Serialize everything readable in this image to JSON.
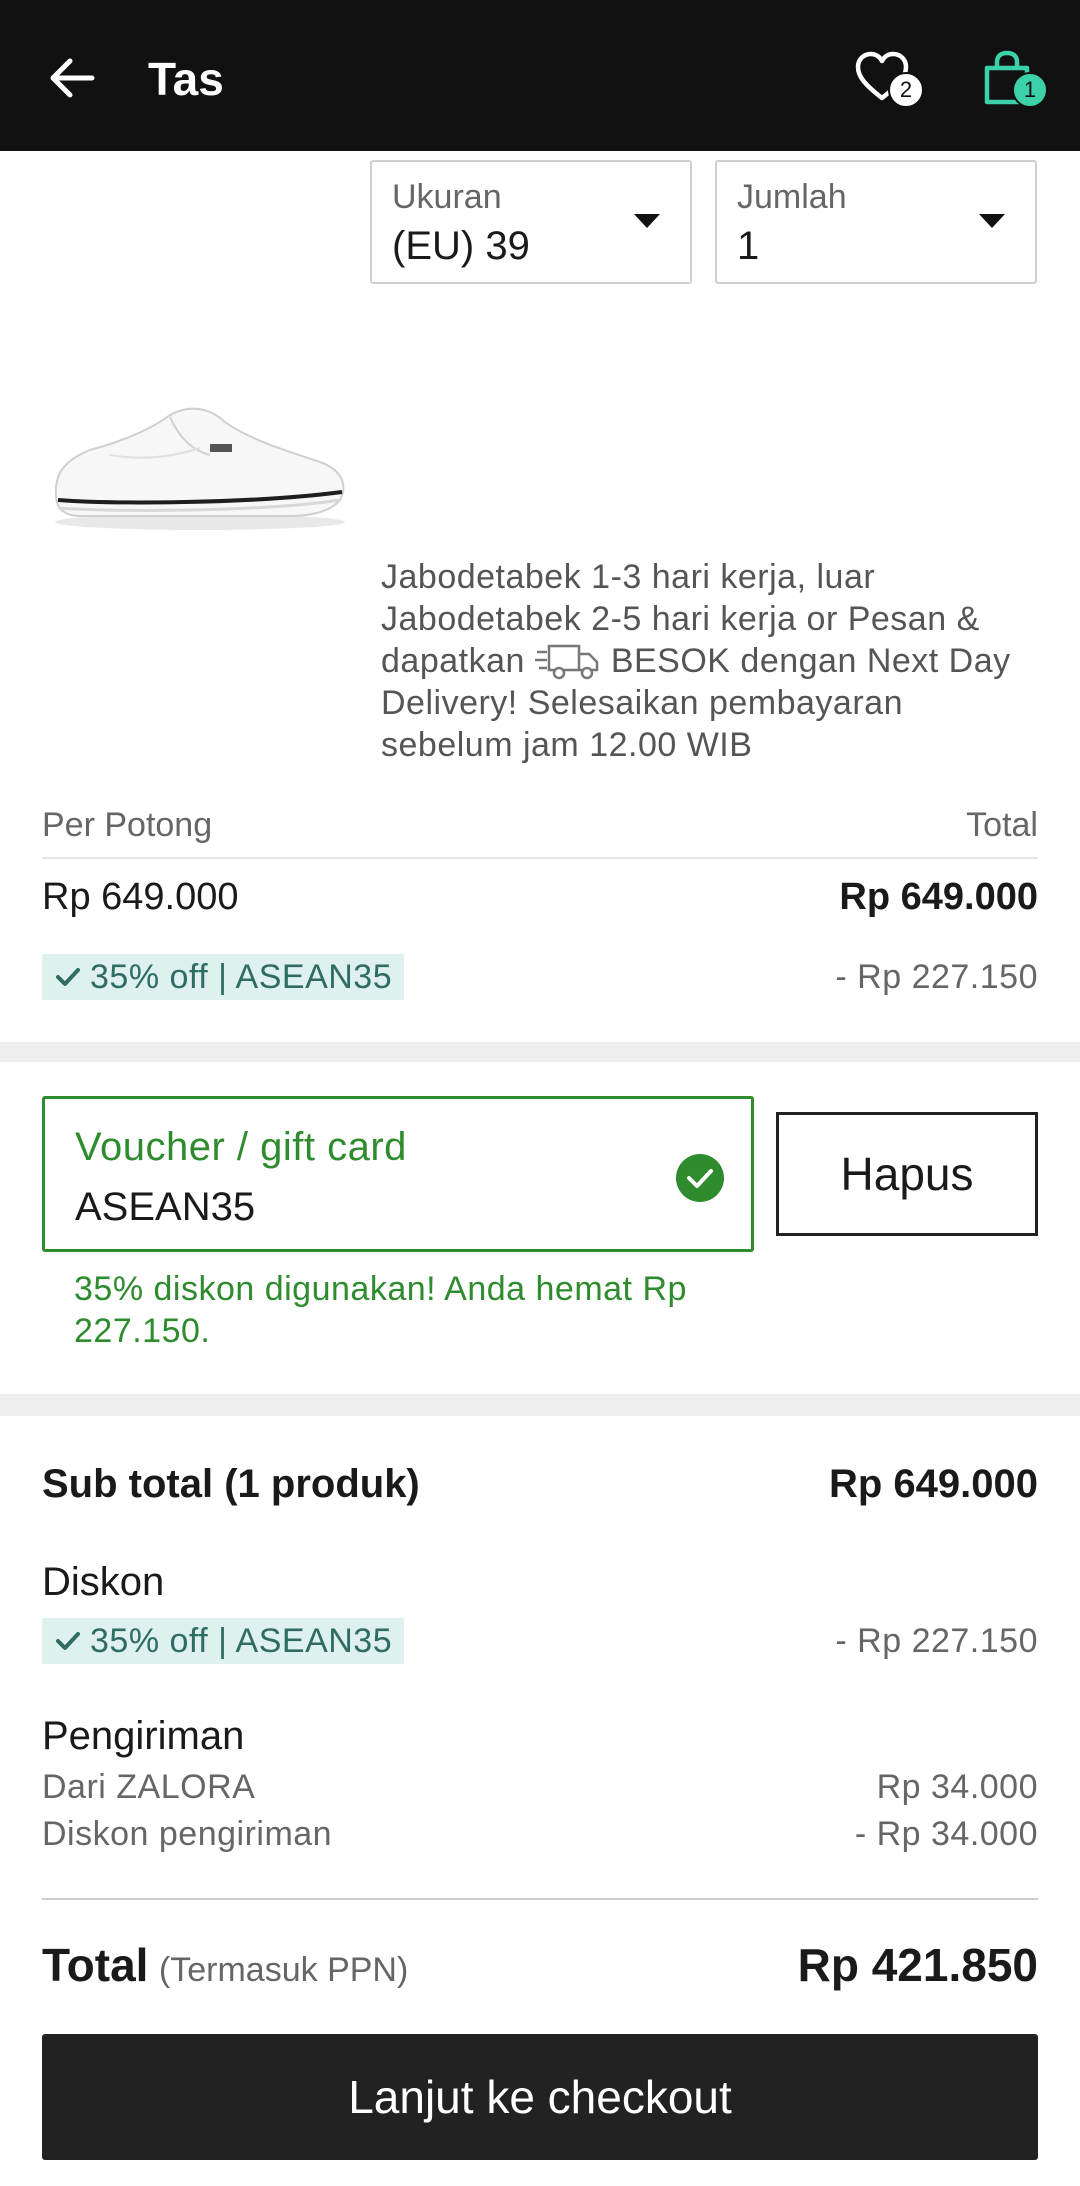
{
  "header": {
    "title": "Tas",
    "wishlist_count": "2",
    "cart_count": "1",
    "colors": {
      "bar": "#111111",
      "cart_accent": "#3cd1a8"
    }
  },
  "item": {
    "size": {
      "label": "Ukuran",
      "value": "(EU) 39"
    },
    "quantity": {
      "label": "Jumlah",
      "value": "1"
    },
    "image_alt": "white sneaker",
    "delivery_part1": "Jabodetabek 1-3 hari kerja, luar Jabodetabek 2-5 hari kerja or Pesan & dapatkan",
    "delivery_part2": "BESOK dengan Next Day Delivery! Selesaikan pembayaran sebelum jam 12.00 WIB",
    "per_piece_label": "Per Potong",
    "total_label": "Total",
    "per_piece_price": "Rp 649.000",
    "total_price": "Rp 649.000",
    "promo_tag": "35% off | ASEAN35",
    "promo_discount": "- Rp 227.150"
  },
  "voucher": {
    "label": "Voucher / gift card",
    "value": "ASEAN35",
    "remove_label": "Hapus",
    "success_message": "35% diskon digunakan! Anda hemat Rp 227.150.",
    "color": "#2e8b2e"
  },
  "summary": {
    "subtotal_label": "Sub total (1 produk)",
    "subtotal_value": "Rp 649.000",
    "discount_label": "Diskon",
    "discount_tag": "35% off | ASEAN35",
    "discount_value": "- Rp 227.150",
    "shipping_label": "Pengiriman",
    "shipping_from_label": "Dari ZALORA",
    "shipping_from_value": "Rp 34.000",
    "shipping_discount_label": "Diskon pengiriman",
    "shipping_discount_value": "- Rp 34.000",
    "total_label": "Total",
    "total_note": "(Termasuk PPN)",
    "total_value": "Rp 421.850"
  },
  "checkout": {
    "label": "Lanjut ke checkout"
  }
}
